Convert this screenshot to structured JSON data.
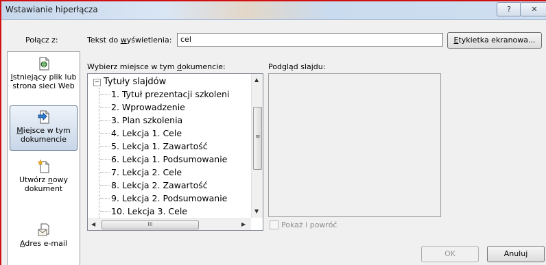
{
  "window": {
    "title": "Wstawianie hiperłącza",
    "help_glyph": "?",
    "close_glyph": "✕"
  },
  "linkbar": {
    "header": "Połącz z:",
    "items": [
      {
        "label_underlined": "I",
        "label_rest": "stniejący plik lub strona sieci Web",
        "icon": "existing-file-icon"
      },
      {
        "label_underlined": "M",
        "label_rest": "iejsce w tym dokumencie",
        "icon": "place-in-document-icon",
        "active": true
      },
      {
        "label_pre": "Utwórz ",
        "label_underlined": "n",
        "label_rest": "owy dokument",
        "icon": "new-document-icon"
      },
      {
        "label_underlined": "A",
        "label_rest": "dres e-mail",
        "icon": "email-address-icon"
      }
    ]
  },
  "display_text": {
    "label_pre": "Tekst do ",
    "label_underlined": "w",
    "label_rest": "yświetlenia:",
    "value": "cel"
  },
  "screentip_button": {
    "label_underlined": "E",
    "label_rest": "tykietka ekranowa..."
  },
  "place_tree": {
    "label_pre": "Wybierz miejsce w tym ",
    "label_underlined": "d",
    "label_rest": "okumencie:",
    "root": "Tytuły slajdów",
    "items": [
      "1. Tytuł prezentacji szkoleni",
      "2. Wprowadzenie",
      "3. Plan szkolenia",
      "4. Lekcja 1. Cele",
      "5. Lekcja 1. Zawartość",
      "6. Lekcja 1. Podsumowanie",
      "7. Lekcja 2. Cele",
      "8. Lekcja 2. Zawartość",
      "9. Lekcja 2. Podsumowanie",
      "10. Lekcja 3. Cele"
    ],
    "scroll_grip": "≡",
    "hscroll_grip": "III"
  },
  "preview": {
    "label": "Podgląd slajdu:",
    "show_and_return": "Pokaż i powróć"
  },
  "buttons": {
    "ok": "OK",
    "cancel": "Anuluj"
  }
}
